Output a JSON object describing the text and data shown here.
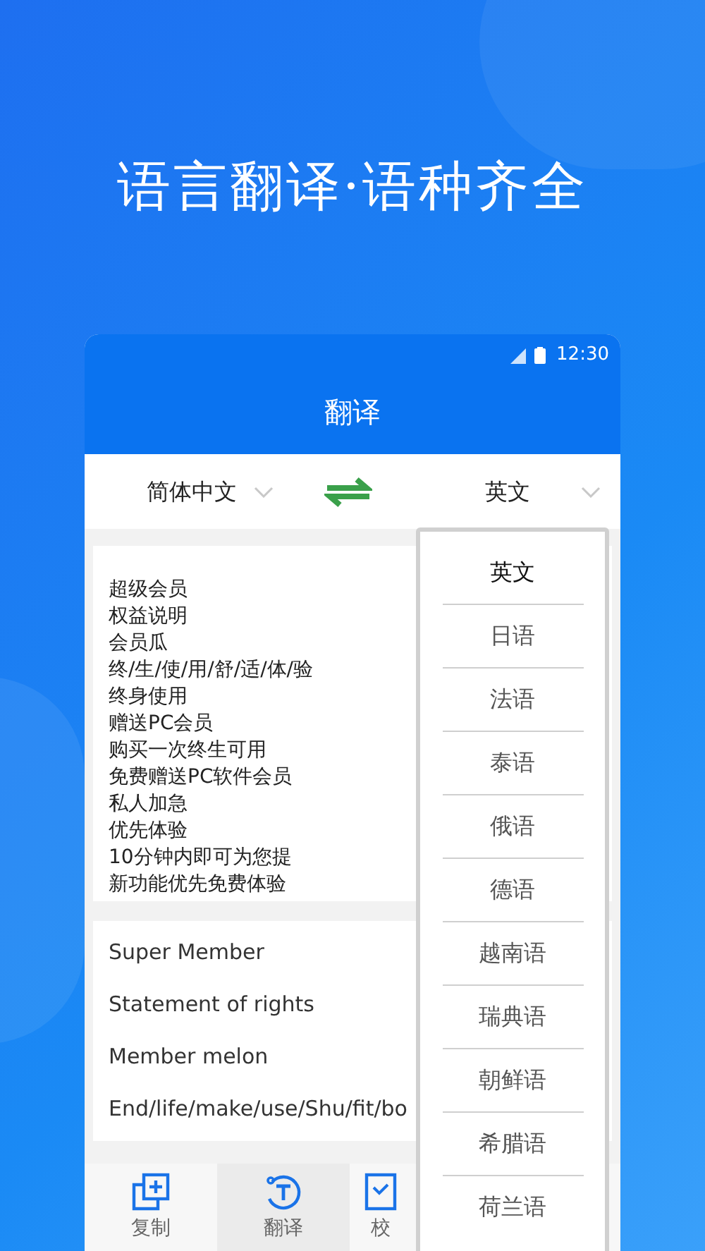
{
  "headline": "语言翻译·语种齐全",
  "status_bar": {
    "time": "12:30"
  },
  "title": "翻译",
  "source_language": "简体中文",
  "target_language": "英文",
  "input_lines": [
    "超级会员",
    "权益说明",
    "会员瓜",
    "终/生/使/用/舒/适/体/验",
    "终身使用",
    "赠送PC会员",
    "购买一次终生可用",
    "免费赠送PC软件会员",
    "私人加急",
    "优先体验",
    "10分钟内即可为您提",
    "新功能优先免费体验"
  ],
  "output_lines": [
    "Super Member",
    "Statement of rights",
    "Member melon",
    "End/life/make/use/Shu/fit/bo"
  ],
  "bottom_nav": [
    {
      "label": "复制",
      "kind": "copy",
      "selected": false
    },
    {
      "label": "翻译",
      "kind": "translate",
      "selected": true
    },
    {
      "label": "校",
      "kind": "check",
      "selected": false
    }
  ],
  "language_menu": [
    {
      "label": "英文",
      "selected": true
    },
    {
      "label": "日语",
      "selected": false
    },
    {
      "label": "法语",
      "selected": false
    },
    {
      "label": "泰语",
      "selected": false
    },
    {
      "label": "俄语",
      "selected": false
    },
    {
      "label": "德语",
      "selected": false
    },
    {
      "label": "越南语",
      "selected": false
    },
    {
      "label": "瑞典语",
      "selected": false
    },
    {
      "label": "朝鲜语",
      "selected": false
    },
    {
      "label": "希腊语",
      "selected": false
    },
    {
      "label": "荷兰语",
      "selected": false
    }
  ]
}
